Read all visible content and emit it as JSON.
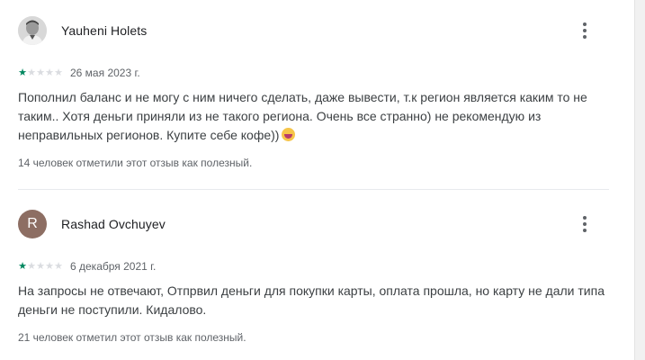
{
  "reviews": [
    {
      "author": "Yauheni Holets",
      "avatar_letter": "",
      "rating": 1,
      "rating_max": 5,
      "date": "26 мая 2023 г.",
      "text": "Пополнил баланс и не могу с ним ничего сделать, даже вывести, т.к регион является каким то не таким.. Хотя деньги приняли из не такого региона. Очень все странно) не рекомендую из неправильных регионов. Купите себе кофе))",
      "emoji": "laughing-emoji",
      "helpful": "14 человек отметили этот отзыв как полезный."
    },
    {
      "author": "Rashad Ovchuyev",
      "avatar_letter": "R",
      "rating": 1,
      "rating_max": 5,
      "date": "6 декабря 2021 г.",
      "text": "На запросы не отвечают, Отпрвил деньги для покупки карты, оплата прошла, но карту не дали типа деньги не поступили. Кидалово.",
      "helpful": "21 человек отметил этот отзыв как полезный."
    }
  ],
  "icons": {
    "menu": "more-vert-icon",
    "star": "star-icon"
  },
  "colors": {
    "star_active": "#01875f",
    "star_inactive": "#dadce0",
    "avatar_letter_bg": "#8d6e63"
  }
}
